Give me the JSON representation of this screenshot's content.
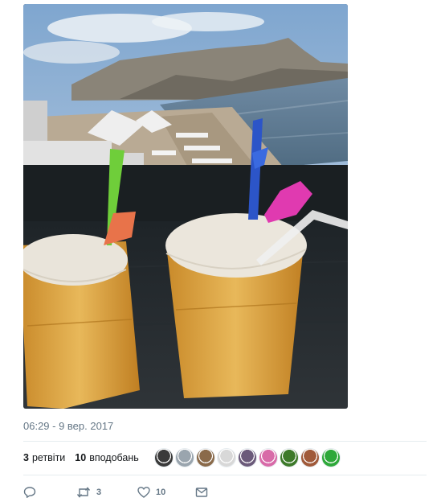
{
  "tweet": {
    "timestamp": "06:29 - 9 вер. 2017",
    "retweets": {
      "count": "3",
      "label": "ретвіти"
    },
    "likes": {
      "count": "10",
      "label": "вподобань"
    },
    "avatar_colors": [
      "#3a3a3a",
      "#9aa5ae",
      "#8a6a4a",
      "#d8d8d8",
      "#6b5a7a",
      "#d86aa8",
      "#3d7a2a",
      "#a05a3a",
      "#2ea83a"
    ],
    "actions": {
      "reply_count": "",
      "retweet_count": "3",
      "like_count": "10"
    },
    "colors": {
      "meta": "#657786",
      "divider": "#e6ecf0"
    }
  }
}
